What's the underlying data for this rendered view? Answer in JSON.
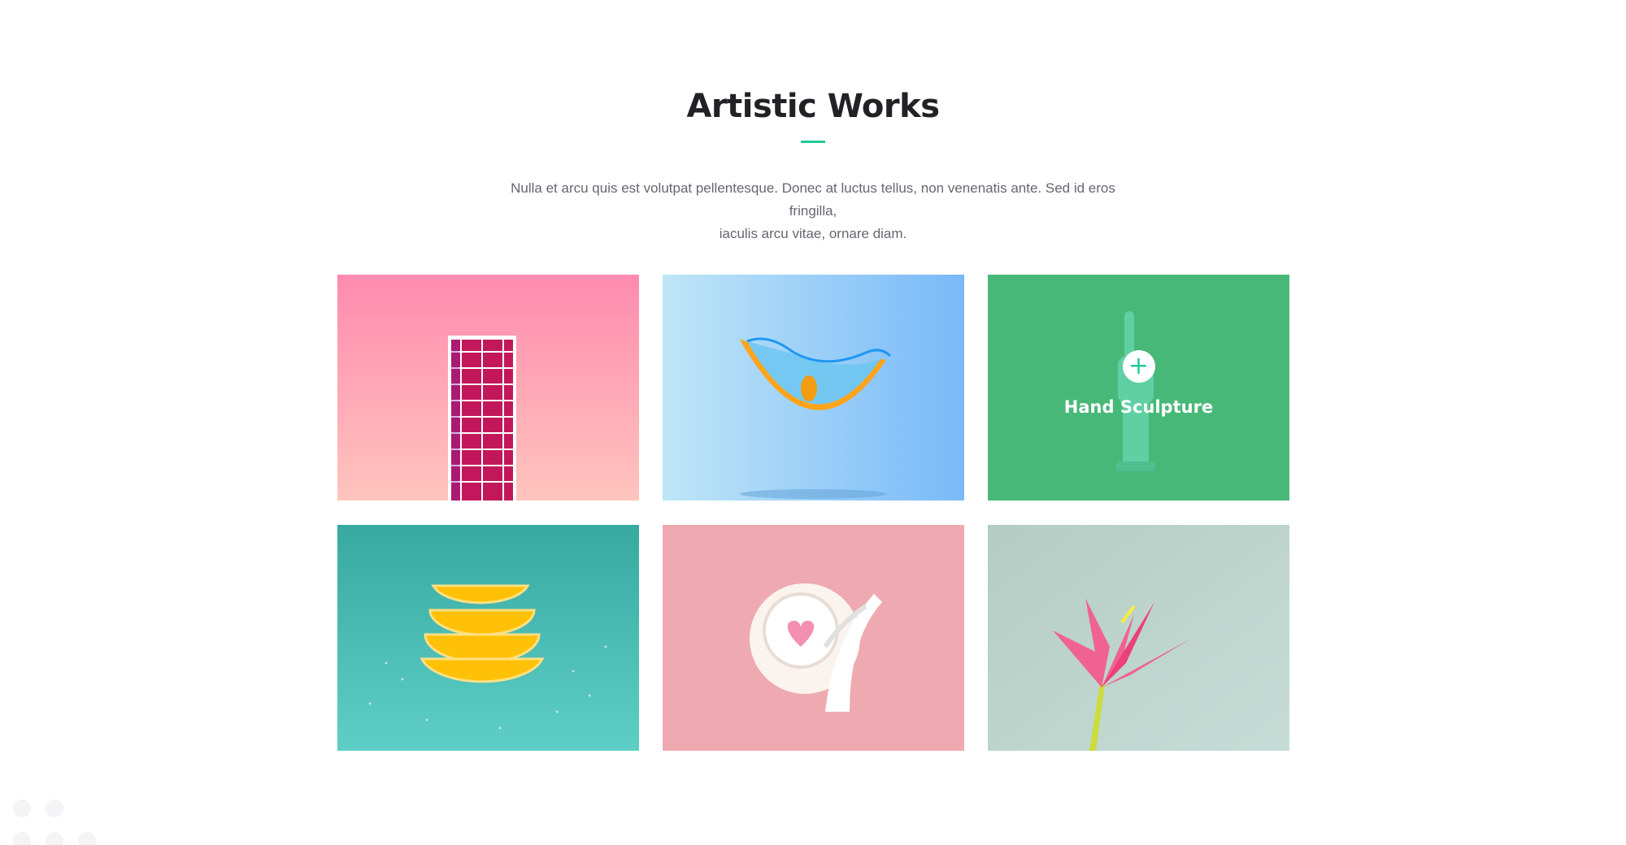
{
  "section": {
    "title": "Artistic Works",
    "description_line1": "Nulla et arcu quis est volutpat pellentesque. Donec at luctus tellus, non venenatis ante. Sed id eros fringilla,",
    "description_line2": "iaculis arcu vitae, ornare diam."
  },
  "accent_color": "#20c997",
  "gallery": {
    "items": [
      {
        "name": "pink building photo",
        "background": "#ff8fb0"
      },
      {
        "name": "orange fishbowl photo",
        "background": "#8cc6f7"
      },
      {
        "name": "hand sculpture photo",
        "background": "#48b879",
        "hover_label": "Hand Sculpture",
        "icon": "plus-icon"
      },
      {
        "name": "lemon slices photo",
        "background": "#49bfb8"
      },
      {
        "name": "gloved hand teacup photo",
        "background": "#eeaab0"
      },
      {
        "name": "paper flower photo",
        "background": "#bcd6cf"
      }
    ]
  }
}
